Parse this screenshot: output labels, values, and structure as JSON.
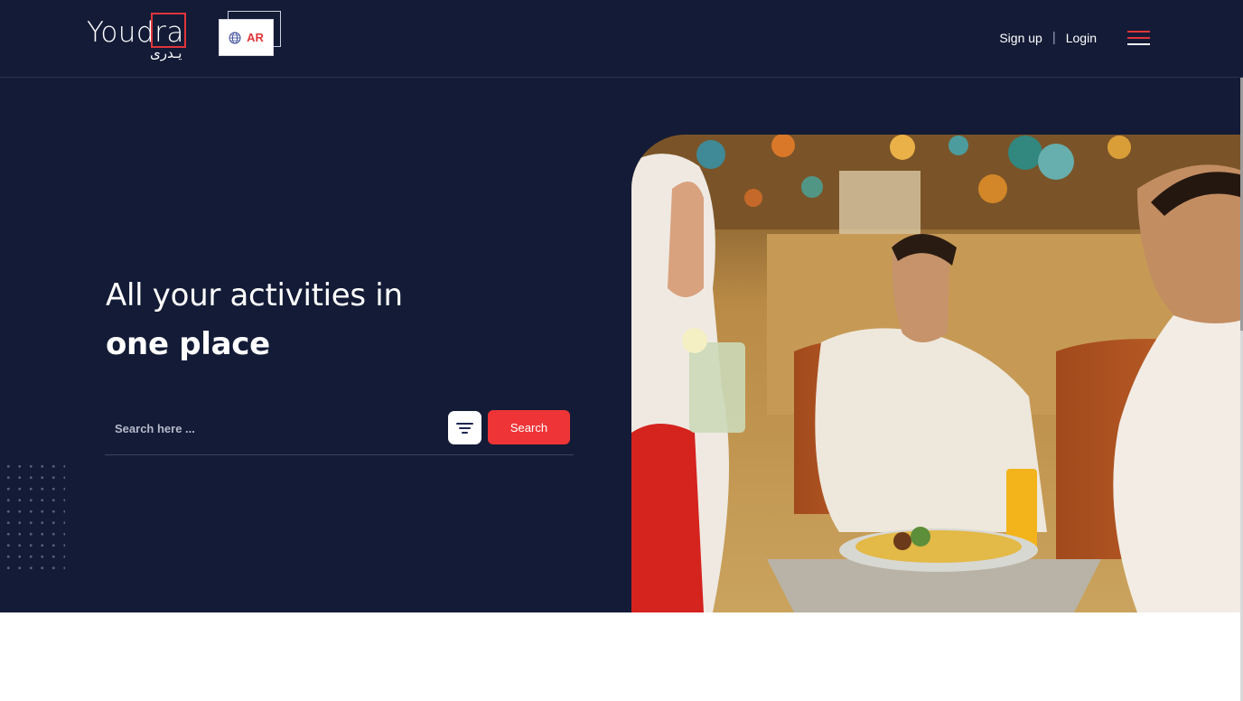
{
  "brand": {
    "name_latin": "Youdra",
    "name_arabic": "يـدرى",
    "accent": "#e0353b",
    "background": "#131b36"
  },
  "language": {
    "label": "AR",
    "icon": "globe-icon"
  },
  "nav": {
    "signup": "Sign up",
    "separator": "|",
    "login": "Login",
    "menu_icon": "hamburger-menu-icon"
  },
  "hero": {
    "headline_line1": "All your activities in",
    "headline_line2": "one place",
    "search_placeholder": "Search here ...",
    "search_value": "",
    "filter_icon": "filter-icon",
    "search_button": "Search",
    "image": "Friends sharing a meal with juice drinks in a restaurant decorated with hanging lanterns"
  }
}
